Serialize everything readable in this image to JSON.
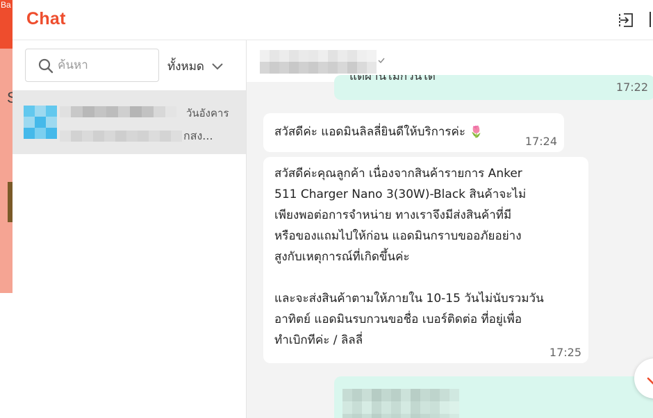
{
  "app": {
    "title": "Chat",
    "accent_color": "#ee4d2d",
    "background_tab_label": "Ba"
  },
  "header": {
    "exit_icon": "exit-to-app-icon"
  },
  "search": {
    "placeholder": "ค้นหา",
    "value": ""
  },
  "filter": {
    "label": "ทั้งหมด"
  },
  "conversations": [
    {
      "date": "วันอังคาร",
      "preview": "กสง...",
      "selected": true
    }
  ],
  "messages": [
    {
      "side": "mine",
      "text": "แต่ผ่านไม่ก็วินได้",
      "time": "17:22"
    },
    {
      "side": "theirs",
      "text": "สวัสดีค่ะ แอดมินลิลลี่ยินดีให้บริการค่ะ",
      "emoji": "🌷",
      "time": "17:24"
    },
    {
      "side": "theirs",
      "lines": [
        "สวัสดีค่ะคุณลูกค้า เนื่องจากสินค้ารายการ Anker",
        "511 Charger Nano 3(30W)-Black สินค้าจะไม่",
        "เพียงพอต่อการจำหน่าย ทางเราจึงมีส่งสินค้าที่มี",
        "หรือของแถมไปให้ก่อน แอดมินกราบขออภัยอย่าง",
        "สูงกับเหตุการณ์ที่เกิดขึ้นค่ะ",
        "",
        "และจะส่งสินค้าตามให้ภายใน 10-15 วันไม่นับรวมวัน",
        "อาทิตย์ แอดมินรบกวนขอชื่อ เบอร์ติดต่อ ที่อยู่เพื่อ",
        "ทำเบิกทีค่ะ / ลิลลี่"
      ],
      "time": "17:25"
    },
    {
      "side": "mine",
      "text": "",
      "time": ""
    }
  ],
  "colors": {
    "mine_bubble": "#d9f7ee",
    "theirs_bubble": "#ffffff",
    "panel_bg": "#f3f3f3",
    "selected_row": "#e8e8e8"
  }
}
